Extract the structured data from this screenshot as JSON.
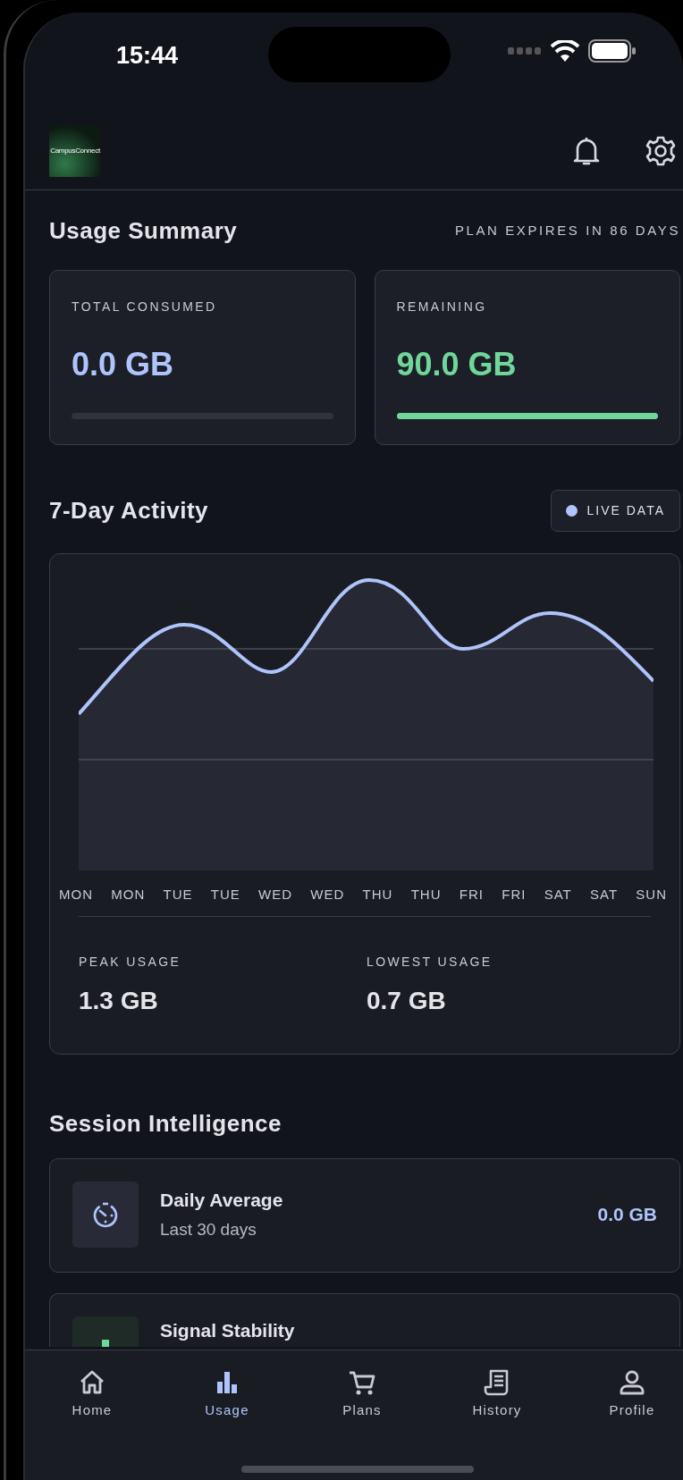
{
  "status_bar": {
    "time": "15:44"
  },
  "header": {
    "logo_text": "CampusConnect"
  },
  "summary": {
    "title": "Usage Summary",
    "plan_expiry": "PLAN EXPIRES IN 86 DAYS",
    "stats": [
      {
        "label": "TOTAL CONSUMED",
        "value": "0.0 GB",
        "color": "#aec4fb",
        "level": 0
      },
      {
        "label": "REMAINING",
        "value": "90.0 GB",
        "color": "#6fd79a",
        "level": 1
      }
    ]
  },
  "activity": {
    "title": "7-Day Activity",
    "live_badge": "LIVE DATA",
    "day_labels": [
      "MON",
      "MON",
      "TUE",
      "TUE",
      "WED",
      "WED",
      "THU",
      "THU",
      "FRI",
      "FRI",
      "SAT",
      "SAT",
      "SUN"
    ],
    "peak": {
      "label": "PEAK USAGE",
      "value": "1.3 GB"
    },
    "lowest": {
      "label": "LOWEST USAGE",
      "value": "0.7 GB"
    }
  },
  "session": {
    "title": "Session Intelligence",
    "items": [
      {
        "kind": "average",
        "title": "Daily Average",
        "subtitle": "Last 30 days",
        "value": "0.0 GB"
      },
      {
        "kind": "signal",
        "title": "Signal Stability"
      }
    ]
  },
  "nav": [
    {
      "kind": "home",
      "label": "Home",
      "selected": false
    },
    {
      "kind": "usage",
      "label": "Usage",
      "selected": true
    },
    {
      "kind": "plans",
      "label": "Plans",
      "selected": false
    },
    {
      "kind": "history",
      "label": "History",
      "selected": false
    },
    {
      "kind": "profile",
      "label": "Profile",
      "selected": false
    }
  ]
}
